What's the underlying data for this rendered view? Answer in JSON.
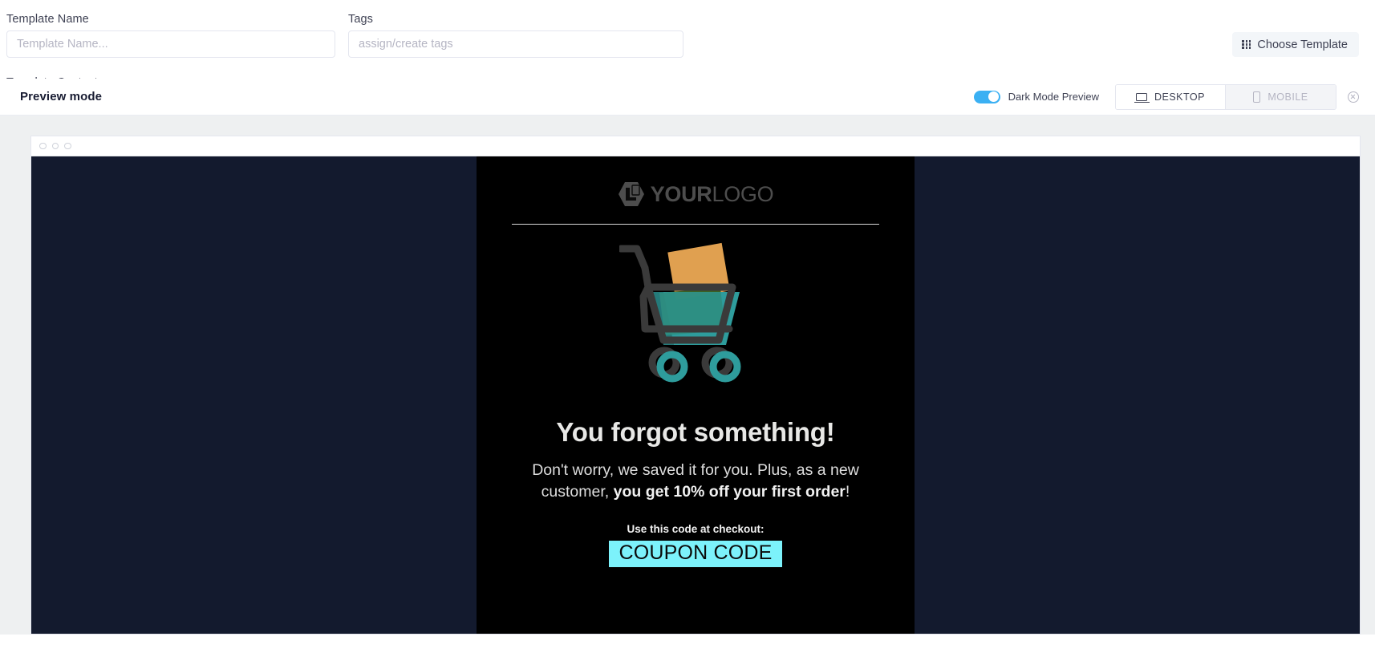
{
  "form": {
    "template_name": {
      "label": "Template Name",
      "value": "",
      "placeholder": "Template Name..."
    },
    "tags": {
      "label": "Tags",
      "value": "",
      "placeholder": "assign/create tags"
    },
    "choose_template_button": "Choose Template",
    "template_content_label": "Template Content"
  },
  "preview_toolbar": {
    "title": "Preview mode",
    "dark_mode_label": "Dark Mode Preview",
    "dark_mode_enabled": "on",
    "viewport_tabs": [
      {
        "label": "DESKTOP",
        "active": "true"
      },
      {
        "label": "MOBILE",
        "active": "false"
      }
    ],
    "close_label": "Close preview"
  },
  "email": {
    "logo": {
      "bold_part": "YOUR",
      "light_part": "LOGO"
    },
    "headline": "You forgot something!",
    "body_part1": "Don't worry, we saved it for you. Plus, as a new customer, ",
    "body_bold": "you get 10% off your first order",
    "body_part3": "!",
    "code_label": "Use this code at checkout:",
    "coupon_code": "COUPON CODE"
  },
  "colors": {
    "accent_toggle": "#3ab0f3",
    "coupon_highlight": "#7cf2fb",
    "email_bg": "#000000",
    "preview_bg": "#131a2e",
    "stage_bg": "#eef0f1",
    "cart_teal": "#2e9c9c",
    "cart_orange": "#e0a050",
    "cart_green": "#2d5a22",
    "cart_outline": "#3a3a3a"
  }
}
